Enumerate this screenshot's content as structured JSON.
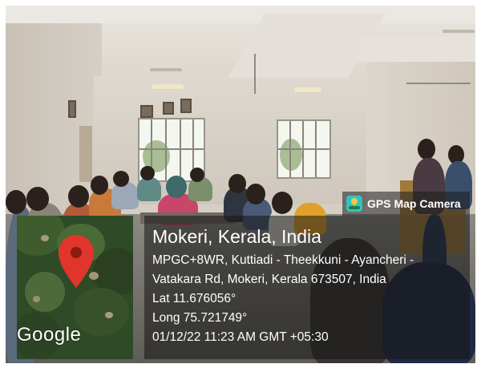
{
  "badge": {
    "app_name": "GPS Map Camera",
    "logo_icon": "gps-map-camera-logo"
  },
  "map": {
    "provider_logo": "Google",
    "pin_icon": "map-pin-icon",
    "pin_color": "#e0352b"
  },
  "location": {
    "title": "Mokeri, Kerala, India",
    "address_line_1": "MPGC+8WR, Kuttiadi - Theekkuni - Ayancheri -",
    "address_line_2": "Vatakara Rd, Mokeri, Kerala 673507, India",
    "latitude": "Lat 11.676056°",
    "longitude": "Long 75.721749°",
    "timestamp": "01/12/22 11:23 AM GMT +05:30"
  },
  "colors": {
    "overlay": "#141414",
    "badge_accent": "#2ec4c6"
  }
}
